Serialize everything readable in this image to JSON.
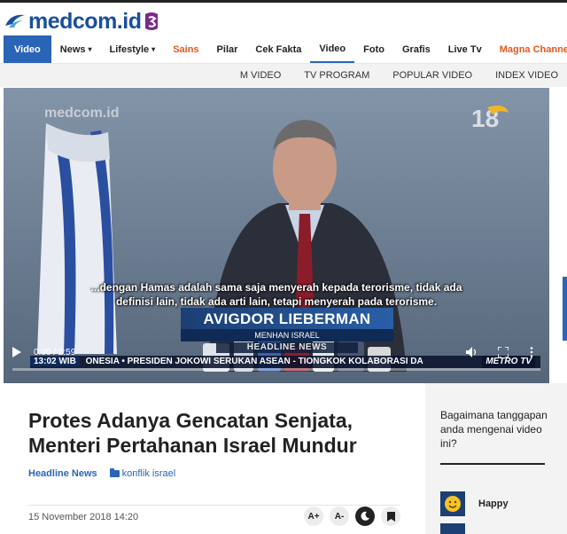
{
  "brand": {
    "logo_text": "medcom.id",
    "accent": "#2a64b6",
    "logo_color": "#1a4f9c"
  },
  "nav": {
    "items": [
      {
        "label": "Video",
        "style": "active"
      },
      {
        "label": "News",
        "has_caret": true
      },
      {
        "label": "Lifestyle",
        "has_caret": true
      },
      {
        "label": "Sains",
        "style": "red"
      },
      {
        "label": "Pilar"
      },
      {
        "label": "Cek Fakta"
      },
      {
        "label": "Video",
        "style": "underline"
      },
      {
        "label": "Foto"
      },
      {
        "label": "Grafis"
      },
      {
        "label": "Live Tv"
      },
      {
        "label": "Magna Channel",
        "style": "red"
      }
    ],
    "caret": "▾"
  },
  "subnav": {
    "items": [
      "M VIDEO",
      "TV PROGRAM",
      "POPULAR VIDEO",
      "INDEX VIDEO"
    ]
  },
  "video": {
    "watermark": "medcom.id",
    "subtitle_line1": "...dengan Hamas adalah sama saja menyerah kepada terorisme, tidak ada",
    "subtitle_line2": "definisi lain, tidak ada arti lain, tetapi menyerah pada terorisme.",
    "name": "AVIGDOR LIEBERMAN",
    "role": "MENHAN ISRAEL",
    "headline_label": "HEADLINE NEWS",
    "ticker_time": "13:02 WIB",
    "ticker_text": "ONESIA  •  PRESIDEN JOKOWI SERUKAN ASEAN - TIONGKOK KOLABORASI DA",
    "channel": "METRO TV",
    "current_time": "0:00 / 2:59",
    "progress": 0
  },
  "article": {
    "title": "Protes Adanya Gencatan Senjata, Menteri Pertahanan Israel Mundur",
    "category": "Headline News",
    "tag": "konflik israel",
    "date": "15 November 2018 14:20",
    "tools": [
      "A+",
      "A-",
      "moon-icon",
      "bookmark-icon"
    ]
  },
  "sidebar": {
    "question": "Bagaimana tanggapan anda mengenai video ini?",
    "reactions": [
      {
        "label": "Happy",
        "icon": "smile-icon"
      }
    ]
  }
}
